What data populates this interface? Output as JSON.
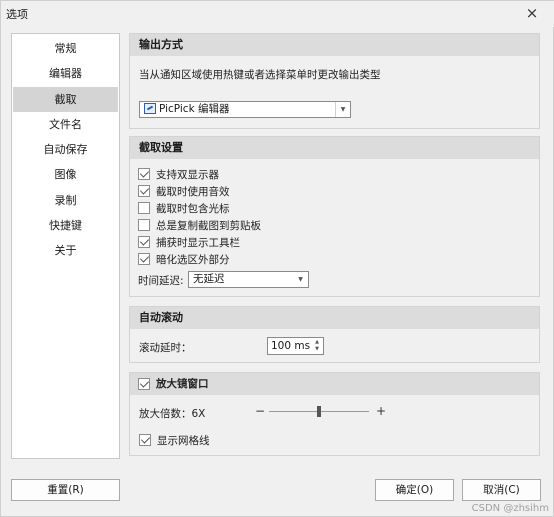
{
  "window": {
    "title": "选项",
    "close_label": "×"
  },
  "sidebar": {
    "items": [
      {
        "label": "常规"
      },
      {
        "label": "编辑器"
      },
      {
        "label": "截取",
        "active": true
      },
      {
        "label": "文件名"
      },
      {
        "label": "自动保存"
      },
      {
        "label": "图像"
      },
      {
        "label": "录制"
      },
      {
        "label": "快捷键"
      },
      {
        "label": "关于"
      }
    ]
  },
  "output": {
    "heading": "输出方式",
    "description": "当从通知区域使用热键或者选择菜单时更改输出类型",
    "selected": "PicPick 编辑器"
  },
  "capture": {
    "heading": "截取设置",
    "options": [
      {
        "label": "支持双显示器",
        "checked": true
      },
      {
        "label": "截取时使用音效",
        "checked": true
      },
      {
        "label": "截取时包含光标",
        "checked": false
      },
      {
        "label": "总是复制截图到剪贴板",
        "checked": false
      },
      {
        "label": "捕获时显示工具栏",
        "checked": true
      },
      {
        "label": "暗化选区外部分",
        "checked": true
      }
    ],
    "delay_label": "时间延迟:",
    "delay_value": "无延迟"
  },
  "autoscroll": {
    "heading": "自动滚动",
    "delay_label": "滚动延时：",
    "delay_value": "100 ms"
  },
  "magnifier": {
    "heading": "放大镜窗口",
    "enabled": true,
    "zoom_label": "放大倍数：6X",
    "zoom_fraction": 0.5,
    "minus": "−",
    "plus": "+",
    "grid_label": "显示网格线",
    "grid_checked": true
  },
  "footer": {
    "reset": "重置(R)",
    "ok": "确定(O)",
    "cancel": "取消(C)"
  },
  "watermark": "CSDN @zhsihm"
}
